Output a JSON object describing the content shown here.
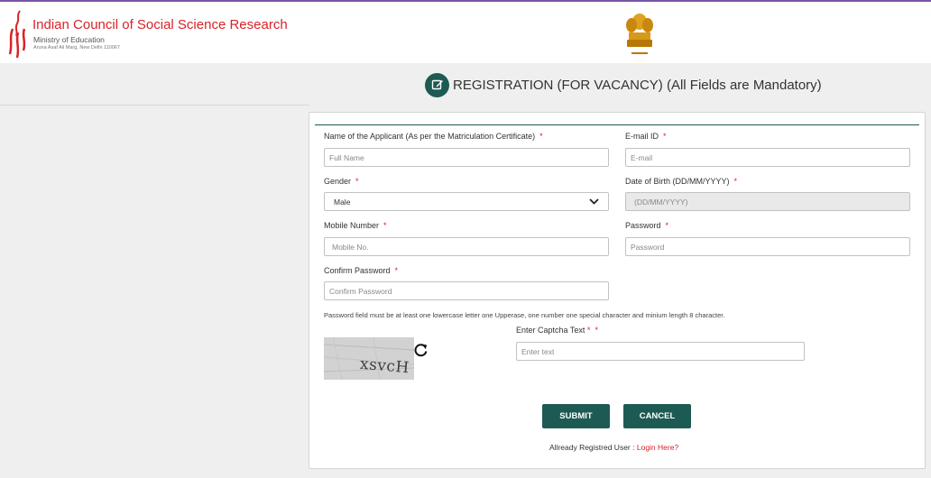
{
  "header": {
    "org_name": "Indian Council of Social Science Research",
    "ministry": "Ministry of Education",
    "address": "Aruna Asaf Ali Marg, New Delhi 110067"
  },
  "page": {
    "heading": "REGISTRATION (FOR VACANCY) (All Fields are Mandatory)"
  },
  "form": {
    "applicant_name": {
      "label": "Name of the Applicant (As per the Matriculation Certificate)",
      "placeholder": "Full Name",
      "value": ""
    },
    "email": {
      "label": "E-mail ID",
      "placeholder": "E-mail",
      "value": ""
    },
    "gender": {
      "label": "Gender",
      "selected": "Male"
    },
    "dob": {
      "label": "Date of Birth (DD/MM/YYYY)",
      "placeholder": "(DD/MM/YYYY)",
      "value": ""
    },
    "mobile": {
      "label": "Mobile Number",
      "placeholder": "Mobile No.",
      "value": ""
    },
    "password": {
      "label": "Password",
      "placeholder": "Password",
      "value": ""
    },
    "confirm_password": {
      "label": "Confirm Password",
      "placeholder": "Confirm Password",
      "value": ""
    },
    "password_note": "Password field must be at least one lowercase letter one Upperase, one number one special character and minium length 8 character.",
    "captcha": {
      "label": "Enter Captcha Text",
      "placeholder": "Enter text",
      "value": "",
      "image_text": "xsvcH"
    },
    "required_mark": "*",
    "submit_label": "SUBMIT",
    "cancel_label": "CANCEL",
    "login_prompt": "Allready Registred User :",
    "login_link": "Login Here?"
  },
  "colors": {
    "brand_red": "#d8232a",
    "primary_teal": "#1e5a54",
    "top_accent": "#7a55a6"
  },
  "icons": {
    "logo": "icssr-logo-icon",
    "emblem": "state-emblem-icon",
    "heading": "edit-icon",
    "select": "chevron-down-icon",
    "captcha_refresh": "refresh-icon"
  }
}
